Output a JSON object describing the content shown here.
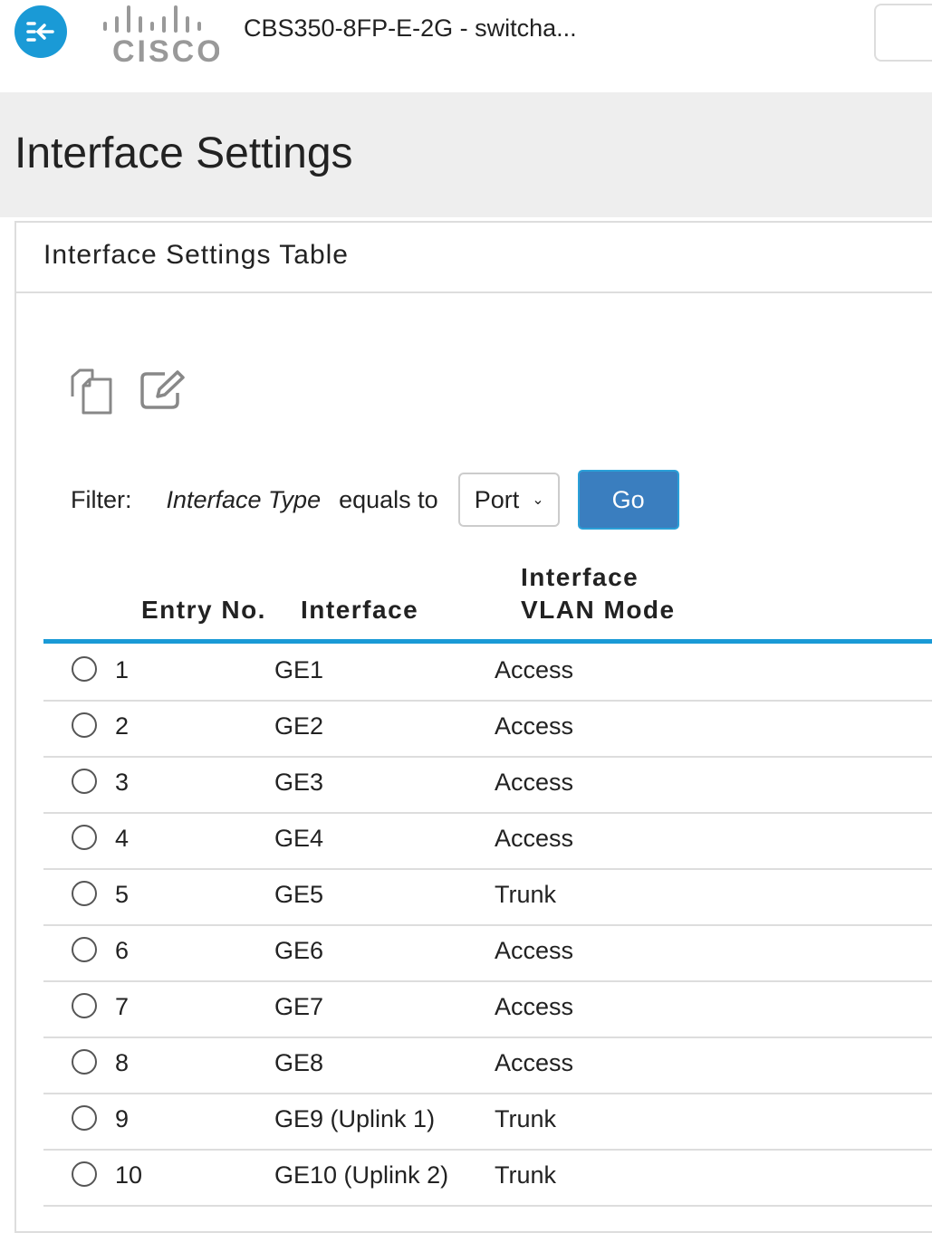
{
  "header": {
    "device_title": "CBS350-8FP-E-2G - switcha...",
    "logo_text": "cisco",
    "nav_icon": "collapse-menu-icon"
  },
  "page": {
    "title": "Interface Settings"
  },
  "panel": {
    "title": "Interface Settings Table"
  },
  "toolbar": {
    "icons": [
      "copy-icon",
      "edit-icon"
    ]
  },
  "filter": {
    "label": "Filter:",
    "field": "Interface Type",
    "operator": "equals to",
    "value": "Port",
    "go_label": "Go"
  },
  "table": {
    "columns": [
      "Entry No.",
      "Interface",
      "Interface",
      "VLAN Mode"
    ],
    "rows": [
      {
        "entry": "1",
        "interface": "GE1",
        "mode": "Access"
      },
      {
        "entry": "2",
        "interface": "GE2",
        "mode": "Access"
      },
      {
        "entry": "3",
        "interface": "GE3",
        "mode": "Access"
      },
      {
        "entry": "4",
        "interface": "GE4",
        "mode": "Access"
      },
      {
        "entry": "5",
        "interface": "GE5",
        "mode": "Trunk"
      },
      {
        "entry": "6",
        "interface": "GE6",
        "mode": "Access"
      },
      {
        "entry": "7",
        "interface": "GE7",
        "mode": "Access"
      },
      {
        "entry": "8",
        "interface": "GE8",
        "mode": "Access"
      },
      {
        "entry": "9",
        "interface": "GE9 (Uplink 1)",
        "mode": "Trunk"
      },
      {
        "entry": "10",
        "interface": "GE10 (Uplink 2)",
        "mode": "Trunk"
      }
    ]
  },
  "colors": {
    "accent": "#1a9ad6",
    "button": "#3a7ebf"
  }
}
